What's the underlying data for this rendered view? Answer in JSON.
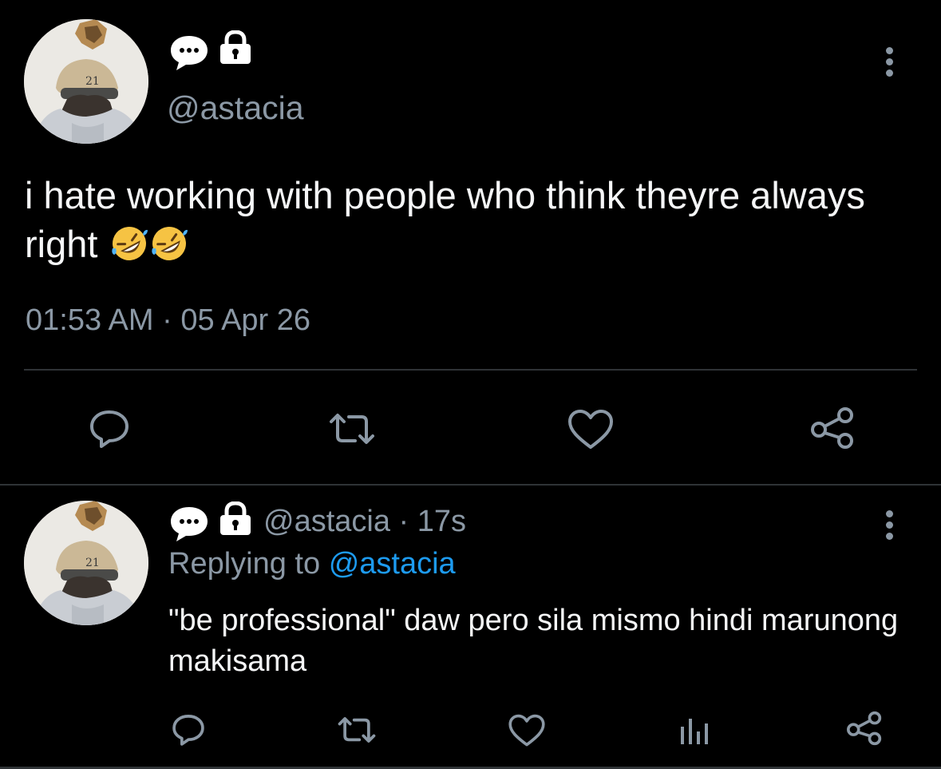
{
  "main_tweet": {
    "handle": "@astacia",
    "text": "i hate working with people who think theyre always right",
    "emoji": [
      "rolling-on-floor-laughing",
      "rolling-on-floor-laughing"
    ],
    "time": "01:53 AM",
    "separator": "·",
    "date": "05 Apr 26",
    "actions": [
      "reply",
      "retweet",
      "like",
      "share"
    ]
  },
  "reply_tweet": {
    "handle": "@astacia",
    "separator": "·",
    "age": "17s",
    "replying_to_label": "Replying to",
    "replying_to_handle": "@astacia",
    "text": "\"be professional\" daw pero sila mismo hindi marunong makisama",
    "actions": [
      "reply",
      "retweet",
      "like",
      "views",
      "share"
    ]
  },
  "colors": {
    "background": "#000000",
    "text": "#f5f6f7",
    "secondary": "#8b98a5",
    "accent": "#1d9bf0",
    "divider": "#2f3336"
  }
}
